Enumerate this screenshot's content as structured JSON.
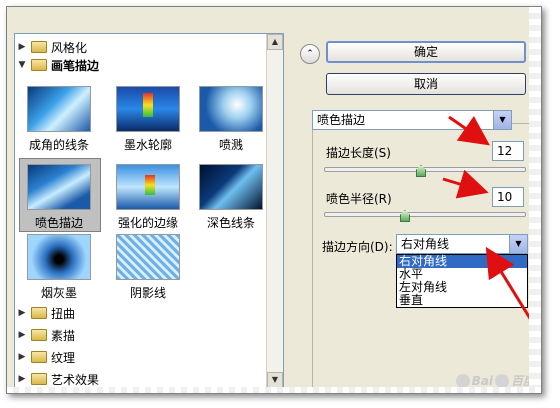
{
  "categories_top": [
    {
      "label": "风格化",
      "expanded": false
    },
    {
      "label": "画笔描边",
      "expanded": true
    }
  ],
  "filters": [
    {
      "label": "成角的线条"
    },
    {
      "label": "墨水轮廓"
    },
    {
      "label": "喷溅"
    },
    {
      "label": "喷色描边"
    },
    {
      "label": "强化的边缘"
    },
    {
      "label": "深色线条"
    },
    {
      "label": "烟灰墨"
    },
    {
      "label": "阴影线"
    }
  ],
  "selected_filter": "喷色描边",
  "categories_bottom": [
    {
      "label": "扭曲"
    },
    {
      "label": "素描"
    },
    {
      "label": "纹理"
    },
    {
      "label": "艺术效果"
    }
  ],
  "buttons": {
    "ok": "确定",
    "cancel": "取消"
  },
  "filter_select": {
    "value": "喷色描边"
  },
  "params": {
    "stroke_length": {
      "label": "描边长度(S)",
      "value": "12",
      "level": 0.48
    },
    "spray_radius": {
      "label": "喷色半径(R)",
      "value": "10",
      "level": 0.4
    },
    "stroke_direction": {
      "label": "描边方向(D):",
      "value": "右对角线",
      "options": [
        "右对角线",
        "水平",
        "左对角线",
        "垂直"
      ]
    }
  },
  "colors": {
    "accent": "#316ac5",
    "arrow": "#e01010",
    "panel": "#ece9d8"
  }
}
